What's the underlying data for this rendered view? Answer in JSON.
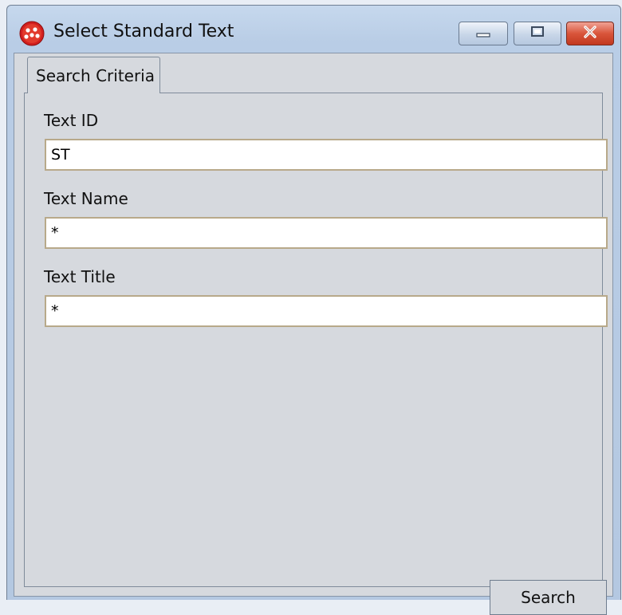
{
  "window": {
    "title": "Select Standard Text",
    "app_icon": "red-dots-app-icon",
    "controls": [
      "minimize-icon",
      "maximize-icon",
      "close-icon"
    ]
  },
  "tabs": [
    {
      "label": "Search Criteria",
      "active": true
    }
  ],
  "form": {
    "text_id": {
      "label": "Text ID",
      "value": "ST"
    },
    "text_name": {
      "label": "Text Name",
      "value": "*"
    },
    "text_title": {
      "label": "Text Title",
      "value": "*"
    }
  },
  "actions": {
    "search_label": "Search"
  },
  "colors": {
    "client_background": "#d6d9de",
    "field_border": "#b8a98a",
    "close_button": "#d9553b",
    "title_bar": "#c6d8ed"
  }
}
